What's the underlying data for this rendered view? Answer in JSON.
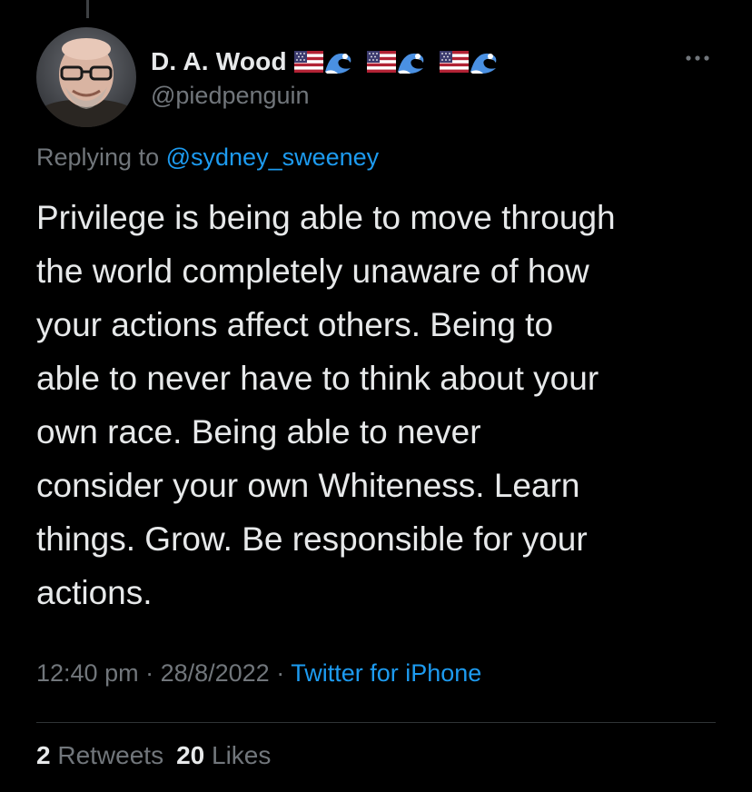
{
  "tweet": {
    "author": {
      "display_name": "D. A. Wood",
      "handle": "@piedpenguin",
      "name_emoji": [
        "us-flag-emoji",
        "wave-emoji",
        "us-flag-emoji",
        "wave-emoji",
        "us-flag-emoji",
        "wave-emoji"
      ]
    },
    "replying_prefix": "Replying to",
    "replying_to": "@sydney_sweeney",
    "text": "Privilege is being able to move through\nthe world completely unaware of how\nyour actions affect others. Being to\nable to never have to think about your\nown race. Being able to never\nconsider your own Whiteness. Learn\nthings. Grow. Be responsible for your\nactions.",
    "time": "12:40 pm",
    "separator": " · ",
    "date": "28/8/2022",
    "source": "Twitter for iPhone",
    "retweets_count": "2",
    "retweets_label": "Retweets",
    "likes_count": "20",
    "likes_label": "Likes"
  },
  "colors": {
    "background": "#000000",
    "text_primary": "#e7e9ea",
    "text_secondary": "#71767b",
    "accent": "#1d9bf0",
    "divider": "#2f3336"
  },
  "icons": {
    "more": "more-dots-icon"
  }
}
